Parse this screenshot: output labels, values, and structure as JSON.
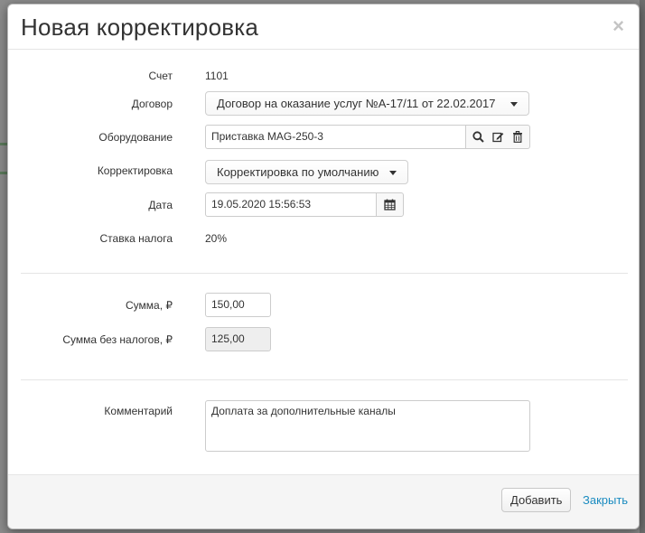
{
  "dialog": {
    "title": "Новая корректировка",
    "close_symbol": "×"
  },
  "form": {
    "account": {
      "label": "Счет",
      "value": "1101"
    },
    "contract": {
      "label": "Договор",
      "value": "Договор на оказание услуг №А-17/11 от 22.02.2017"
    },
    "equipment": {
      "label": "Оборудование",
      "value": "Приставка MAG-250-3",
      "icons": [
        "search-icon",
        "edit-icon",
        "trash-icon"
      ]
    },
    "correction": {
      "label": "Корректировка",
      "value": "Корректировка по умолчанию"
    },
    "date": {
      "label": "Дата",
      "value": "19.05.2020 15:56:53",
      "icon": "calendar-icon"
    },
    "tax_rate": {
      "label": "Ставка налога",
      "value": "20%"
    },
    "amount": {
      "label": "Сумма, ₽",
      "value": "150,00"
    },
    "amount_no_tax": {
      "label": "Сумма без налогов, ₽",
      "value": "125,00"
    },
    "comment": {
      "label": "Комментарий",
      "value": "Доплата за дополнительные каналы"
    }
  },
  "footer": {
    "add_label": "Добавить",
    "close_label": "Закрыть"
  },
  "colors": {
    "link": "#1a8bc0",
    "readonly_bg": "#eeeeee"
  }
}
